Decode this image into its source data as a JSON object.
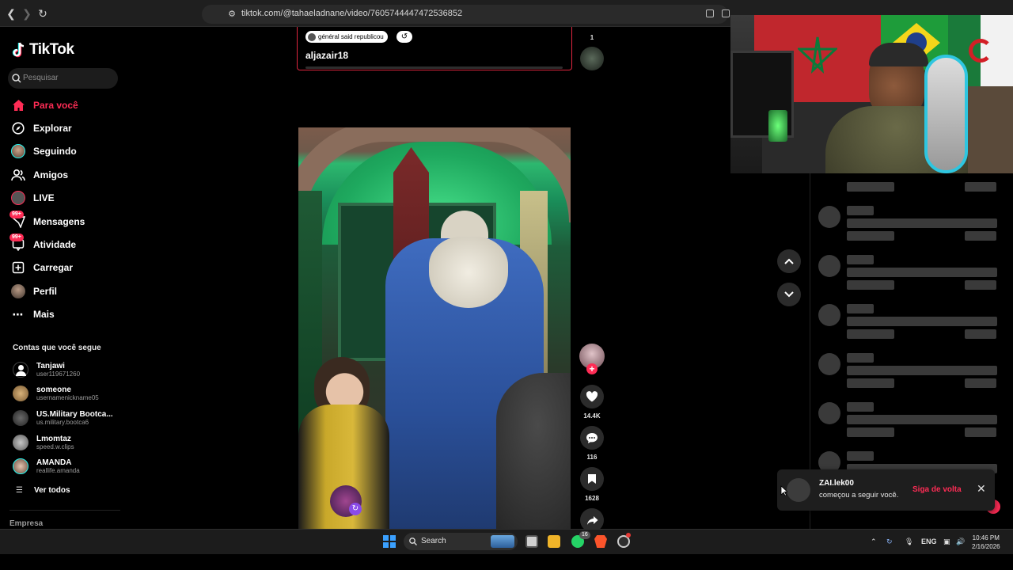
{
  "browser": {
    "url": "tiktok.com/@tahaeladnane/video/7605744447472536852",
    "icons": [
      "back-icon",
      "forward-icon",
      "reload-icon",
      "bookmark-icon",
      "site-settings-icon"
    ]
  },
  "sidebar": {
    "logo": "TikTok",
    "search_placeholder": "Pesquisar",
    "nav": [
      {
        "label": "Para você",
        "icon": "home-icon",
        "active": true
      },
      {
        "label": "Explorar",
        "icon": "compass-icon"
      },
      {
        "label": "Seguindo",
        "icon": "following-avatar-icon"
      },
      {
        "label": "Amigos",
        "icon": "friends-icon"
      },
      {
        "label": "LIVE",
        "icon": "live-icon"
      },
      {
        "label": "Mensagens",
        "icon": "messages-icon",
        "badge": "99+"
      },
      {
        "label": "Atividade",
        "icon": "activity-icon",
        "badge": "99+"
      },
      {
        "label": "Carregar",
        "icon": "upload-icon"
      },
      {
        "label": "Perfil",
        "icon": "profile-avatar-icon"
      },
      {
        "label": "Mais",
        "icon": "more-icon"
      }
    ],
    "following_title": "Contas que você segue",
    "accounts": [
      {
        "name": "Tanjawi",
        "user": "user119671260"
      },
      {
        "name": "someone",
        "user": "usernamenickname05"
      },
      {
        "name": "US.Military Bootca...",
        "user": "us.military.bootca6"
      },
      {
        "name": "Lmomtaz",
        "user": "speed.w.clips"
      },
      {
        "name": "AMANDA",
        "user": "reallife.amanda"
      }
    ],
    "see_all": "Ver todos",
    "footer": "Empresa"
  },
  "prev_video": {
    "tag": "général said republicou",
    "username": "aljazair18",
    "side_count": "1"
  },
  "actions": {
    "likes": "14.4K",
    "comments": "116",
    "saves": "1628"
  },
  "notification": {
    "user": "ZAI.lek00",
    "message": "começou a seguir você.",
    "follow_back": "Siga de volta"
  },
  "taskbar": {
    "search_label": "Search",
    "lang": "ENG",
    "time": "10:46 PM",
    "date": "2/16/2026",
    "whatsapp_badge": "16"
  },
  "colors": {
    "accent": "#fe2c55",
    "card_border": "#e0263f"
  }
}
